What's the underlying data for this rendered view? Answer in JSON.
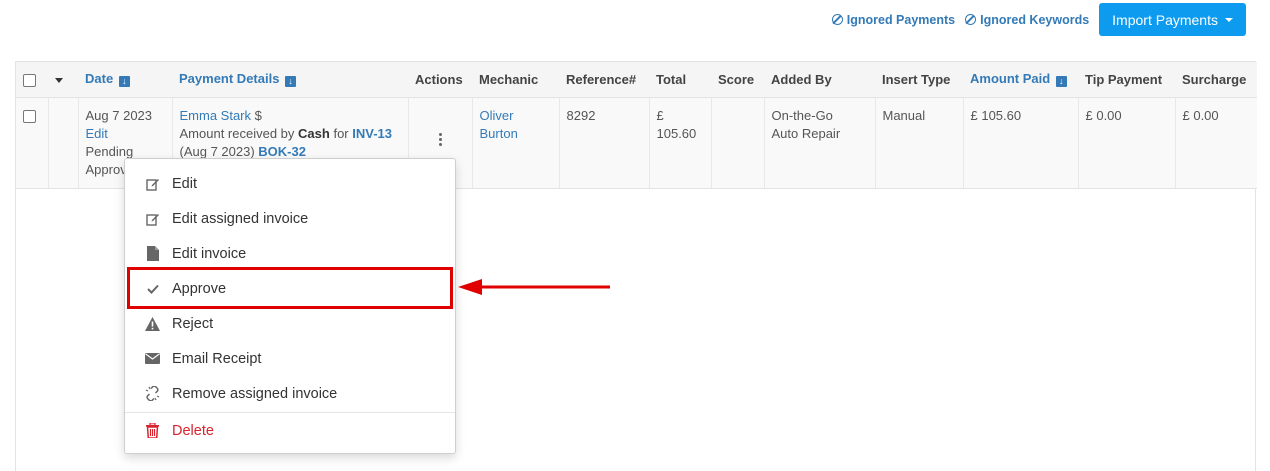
{
  "toolbar": {
    "ignored_payments": "Ignored Payments",
    "ignored_keywords": "Ignored Keywords",
    "import_payments": "Import Payments"
  },
  "table": {
    "headers": {
      "date": "Date",
      "payment_details": "Payment Details",
      "actions": "Actions",
      "mechanic": "Mechanic",
      "reference": "Reference#",
      "total": "Total",
      "score": "Score",
      "added_by": "Added By",
      "insert_type": "Insert Type",
      "amount_paid": "Amount Paid",
      "tip_payment": "Tip Payment",
      "surcharge": "Surcharge"
    },
    "row": {
      "date": "Aug 7 2023",
      "edit": "Edit",
      "status_line1": "Pending",
      "status_line2": "Approval",
      "customer": "Emma Stark",
      "currency_symbol": "$",
      "detail_prefix": "Amount received by",
      "method": "Cash",
      "detail_for": "for",
      "invoice": "INV-13",
      "invoice_date": "(Aug 7 2023)",
      "booking": "BOK-32",
      "mechanic_first": "Oliver",
      "mechanic_last": "Burton",
      "reference": "8292",
      "total_currency": "£",
      "total_value": "105.60",
      "score": "",
      "added_by_line1": "On-the-Go",
      "added_by_line2": "Auto Repair",
      "insert_type": "Manual",
      "amount_paid": "£ 105.60",
      "tip_payment": "£ 0.00",
      "surcharge": "£ 0.00"
    }
  },
  "menu": {
    "edit": "Edit",
    "edit_assigned_invoice": "Edit assigned invoice",
    "edit_invoice": "Edit invoice",
    "approve": "Approve",
    "reject": "Reject",
    "email_receipt": "Email Receipt",
    "remove_assigned_invoice": "Remove assigned invoice",
    "delete": "Delete"
  },
  "colors": {
    "link": "#337ab7",
    "primary_button": "#0d9bf0",
    "danger": "#d9232d",
    "annotation": "#e00000"
  }
}
